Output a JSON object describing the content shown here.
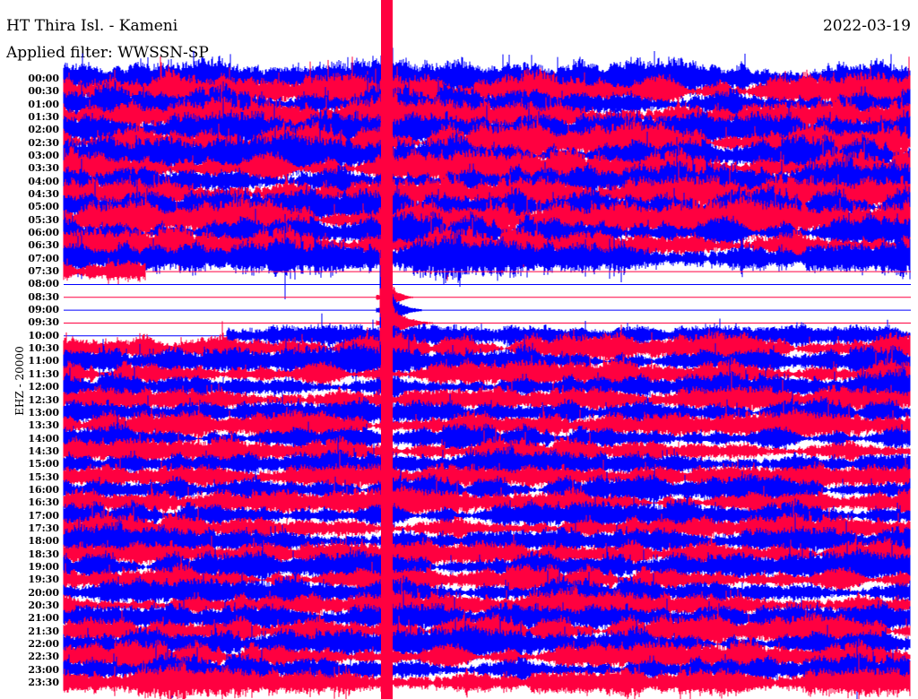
{
  "header": {
    "station": "HT Thira Isl. - Kameni",
    "filter": "Applied filter: WWSSN-SP",
    "date": "2022-03-19"
  },
  "chart_data": {
    "type": "line",
    "title": "HT Thira Isl. - Kameni",
    "ylabel": "EHZ - 20000",
    "row_labels": [
      "00:00",
      "00:30",
      "01:00",
      "01:30",
      "02:00",
      "02:30",
      "03:00",
      "03:30",
      "04:00",
      "04:30",
      "05:00",
      "05:30",
      "06:00",
      "06:30",
      "07:00",
      "07:30",
      "08:00",
      "08:30",
      "09:00",
      "09:30",
      "10:00",
      "10:30",
      "11:00",
      "11:30",
      "12:00",
      "12:30",
      "13:00",
      "13:30",
      "14:00",
      "14:30",
      "15:00",
      "15:30",
      "16:00",
      "16:30",
      "17:00",
      "17:30",
      "18:00",
      "18:30",
      "19:00",
      "19:30",
      "20:00",
      "20:30",
      "21:00",
      "21:30",
      "22:00",
      "22:30",
      "23:00",
      "23:30"
    ],
    "row_amplitude": [
      1,
      1,
      1,
      1,
      1,
      1,
      1,
      1,
      1,
      1,
      1,
      1,
      1,
      1,
      1,
      0.65,
      0,
      0,
      0,
      0,
      0.6,
      0.75,
      0.75,
      0.75,
      0.75,
      0.75,
      0.7,
      0.7,
      0.7,
      0.7,
      0.7,
      0.7,
      0.7,
      0.7,
      0.75,
      0.75,
      0.75,
      0.75,
      0.75,
      0.75,
      0.75,
      0.75,
      0.8,
      0.8,
      0.8,
      0.8,
      0.8,
      0.8
    ],
    "data_gap": {
      "start": "07:33",
      "end": "10:12"
    },
    "large_event_time": "09:45",
    "colors": [
      "#0000ff",
      "#ff0040"
    ]
  }
}
